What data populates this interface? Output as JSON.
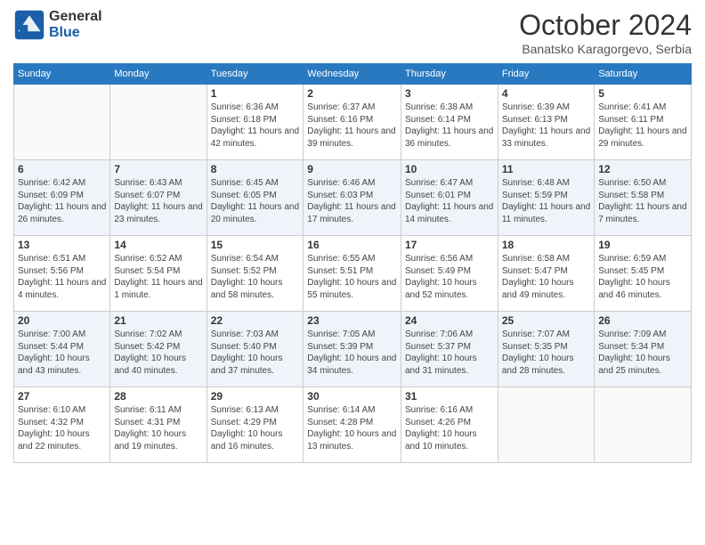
{
  "logo": {
    "general": "General",
    "blue": "Blue"
  },
  "header": {
    "month": "October 2024",
    "location": "Banatsko Karagorgevo, Serbia"
  },
  "days_of_week": [
    "Sunday",
    "Monday",
    "Tuesday",
    "Wednesday",
    "Thursday",
    "Friday",
    "Saturday"
  ],
  "weeks": [
    [
      {
        "day": null,
        "info": null
      },
      {
        "day": null,
        "info": null
      },
      {
        "day": "1",
        "info": "Sunrise: 6:36 AM\nSunset: 6:18 PM\nDaylight: 11 hours and 42 minutes."
      },
      {
        "day": "2",
        "info": "Sunrise: 6:37 AM\nSunset: 6:16 PM\nDaylight: 11 hours and 39 minutes."
      },
      {
        "day": "3",
        "info": "Sunrise: 6:38 AM\nSunset: 6:14 PM\nDaylight: 11 hours and 36 minutes."
      },
      {
        "day": "4",
        "info": "Sunrise: 6:39 AM\nSunset: 6:13 PM\nDaylight: 11 hours and 33 minutes."
      },
      {
        "day": "5",
        "info": "Sunrise: 6:41 AM\nSunset: 6:11 PM\nDaylight: 11 hours and 29 minutes."
      }
    ],
    [
      {
        "day": "6",
        "info": "Sunrise: 6:42 AM\nSunset: 6:09 PM\nDaylight: 11 hours and 26 minutes."
      },
      {
        "day": "7",
        "info": "Sunrise: 6:43 AM\nSunset: 6:07 PM\nDaylight: 11 hours and 23 minutes."
      },
      {
        "day": "8",
        "info": "Sunrise: 6:45 AM\nSunset: 6:05 PM\nDaylight: 11 hours and 20 minutes."
      },
      {
        "day": "9",
        "info": "Sunrise: 6:46 AM\nSunset: 6:03 PM\nDaylight: 11 hours and 17 minutes."
      },
      {
        "day": "10",
        "info": "Sunrise: 6:47 AM\nSunset: 6:01 PM\nDaylight: 11 hours and 14 minutes."
      },
      {
        "day": "11",
        "info": "Sunrise: 6:48 AM\nSunset: 5:59 PM\nDaylight: 11 hours and 11 minutes."
      },
      {
        "day": "12",
        "info": "Sunrise: 6:50 AM\nSunset: 5:58 PM\nDaylight: 11 hours and 7 minutes."
      }
    ],
    [
      {
        "day": "13",
        "info": "Sunrise: 6:51 AM\nSunset: 5:56 PM\nDaylight: 11 hours and 4 minutes."
      },
      {
        "day": "14",
        "info": "Sunrise: 6:52 AM\nSunset: 5:54 PM\nDaylight: 11 hours and 1 minute."
      },
      {
        "day": "15",
        "info": "Sunrise: 6:54 AM\nSunset: 5:52 PM\nDaylight: 10 hours and 58 minutes."
      },
      {
        "day": "16",
        "info": "Sunrise: 6:55 AM\nSunset: 5:51 PM\nDaylight: 10 hours and 55 minutes."
      },
      {
        "day": "17",
        "info": "Sunrise: 6:56 AM\nSunset: 5:49 PM\nDaylight: 10 hours and 52 minutes."
      },
      {
        "day": "18",
        "info": "Sunrise: 6:58 AM\nSunset: 5:47 PM\nDaylight: 10 hours and 49 minutes."
      },
      {
        "day": "19",
        "info": "Sunrise: 6:59 AM\nSunset: 5:45 PM\nDaylight: 10 hours and 46 minutes."
      }
    ],
    [
      {
        "day": "20",
        "info": "Sunrise: 7:00 AM\nSunset: 5:44 PM\nDaylight: 10 hours and 43 minutes."
      },
      {
        "day": "21",
        "info": "Sunrise: 7:02 AM\nSunset: 5:42 PM\nDaylight: 10 hours and 40 minutes."
      },
      {
        "day": "22",
        "info": "Sunrise: 7:03 AM\nSunset: 5:40 PM\nDaylight: 10 hours and 37 minutes."
      },
      {
        "day": "23",
        "info": "Sunrise: 7:05 AM\nSunset: 5:39 PM\nDaylight: 10 hours and 34 minutes."
      },
      {
        "day": "24",
        "info": "Sunrise: 7:06 AM\nSunset: 5:37 PM\nDaylight: 10 hours and 31 minutes."
      },
      {
        "day": "25",
        "info": "Sunrise: 7:07 AM\nSunset: 5:35 PM\nDaylight: 10 hours and 28 minutes."
      },
      {
        "day": "26",
        "info": "Sunrise: 7:09 AM\nSunset: 5:34 PM\nDaylight: 10 hours and 25 minutes."
      }
    ],
    [
      {
        "day": "27",
        "info": "Sunrise: 6:10 AM\nSunset: 4:32 PM\nDaylight: 10 hours and 22 minutes."
      },
      {
        "day": "28",
        "info": "Sunrise: 6:11 AM\nSunset: 4:31 PM\nDaylight: 10 hours and 19 minutes."
      },
      {
        "day": "29",
        "info": "Sunrise: 6:13 AM\nSunset: 4:29 PM\nDaylight: 10 hours and 16 minutes."
      },
      {
        "day": "30",
        "info": "Sunrise: 6:14 AM\nSunset: 4:28 PM\nDaylight: 10 hours and 13 minutes."
      },
      {
        "day": "31",
        "info": "Sunrise: 6:16 AM\nSunset: 4:26 PM\nDaylight: 10 hours and 10 minutes."
      },
      {
        "day": null,
        "info": null
      },
      {
        "day": null,
        "info": null
      }
    ]
  ]
}
